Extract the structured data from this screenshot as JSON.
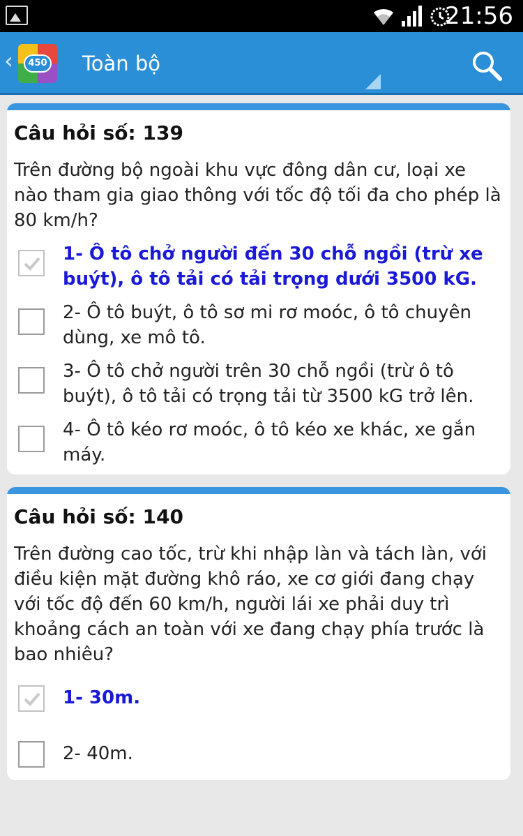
{
  "status_bar": {
    "time": "21:56",
    "icons": [
      "gallery-icon",
      "wifi-icon",
      "signal-icon",
      "alarm-icon"
    ]
  },
  "action_bar": {
    "title": "Toàn bộ",
    "logo_text": "450",
    "icons": [
      "back-chevron-icon",
      "search-icon"
    ],
    "color": "#2a8fd6"
  },
  "questions": [
    {
      "title": "Câu hỏi số: 139",
      "text": "Trên đường bộ ngoài khu vực đông dân cư, loại xe nào tham gia giao thông với tốc độ tối đa cho phép là 80 km/h?",
      "options": [
        {
          "label": "1- Ô tô chở người đến 30 chỗ ngồi (trừ xe buýt), ô tô tải có tải trọng dưới 3500 kG.",
          "checked": true,
          "correct": true
        },
        {
          "label": "2- Ô tô buýt, ô tô sơ mi rơ moóc, ô tô chuyên dùng, xe mô tô.",
          "checked": false,
          "correct": false
        },
        {
          "label": "3- Ô tô chở người trên 30 chỗ ngồi (trừ ô tô buýt), ô tô tải có trọng tải từ 3500 kG trở lên.",
          "checked": false,
          "correct": false
        },
        {
          "label": "4- Ô tô kéo rơ moóc, ô tô kéo xe khác, xe gắn máy.",
          "checked": false,
          "correct": false
        }
      ]
    },
    {
      "title": "Câu hỏi số: 140",
      "text": "Trên đường cao tốc, trừ khi nhập làn và tách làn, với điều kiện mặt đường khô ráo, xe cơ giới đang chạy với tốc độ đến 60 km/h, người lái xe phải duy trì khoảng cách an toàn với xe đang chạy phía trước là bao nhiêu?",
      "options": [
        {
          "label": "1- 30m.",
          "checked": true,
          "correct": true
        },
        {
          "label": "2- 40m.",
          "checked": false,
          "correct": false
        }
      ]
    }
  ],
  "colors": {
    "correct_answer": "#1a1ad6",
    "card_accent": "#3a95e0",
    "background": "#e8e8e8"
  }
}
